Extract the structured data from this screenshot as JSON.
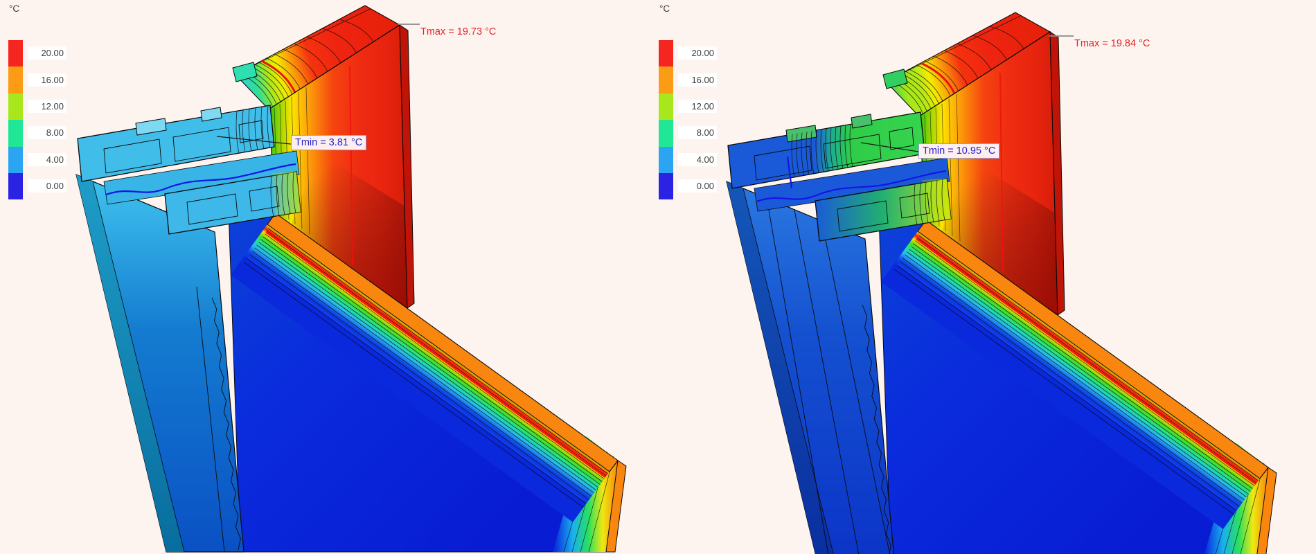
{
  "legend": {
    "unit": "°C",
    "values": [
      "20.00",
      "16.00",
      "12.00",
      "8.00",
      "4.00",
      "0.00"
    ],
    "colors": [
      "#f5261f",
      "#fb9b16",
      "#a8e71b",
      "#20e795",
      "#2ba4f2",
      "#2a23e3"
    ]
  },
  "panels": [
    {
      "name": "left-view",
      "tmax_label": "Tmax = 19.73 °C",
      "tmin_label": "Tmin = 3.81 °C",
      "theme": {
        "frame_cold": "#41bdea",
        "frame_warm": "#41bdea",
        "frame_block": "#7fd9f3",
        "jamb_top": "#3fc2ee",
        "jamb_mid": "#147cd0",
        "jamb_bottom": "#0a50c4",
        "jamb_edge_top": "#1e9cc8",
        "jamb_edge_bottom": "#086d9e",
        "gap": "#38b4e6",
        "band_start": "#38c8e8",
        "band_mid": "#30e090",
        "tip_block": "#2ee0b0"
      }
    },
    {
      "name": "right-view",
      "tmax_label": "Tmax = 19.84 °C",
      "tmin_label": "Tmin = 10.95 °C",
      "theme": {
        "frame_cold": "#1a5ad8",
        "frame_warm": "#2ecc48",
        "frame_block": "#49c06c",
        "jamb_top": "#2a78e0",
        "jamb_mid": "#1450d0",
        "jamb_bottom": "#0c34c8",
        "jamb_edge_top": "#1456b8",
        "jamb_edge_bottom": "#0a2ea0",
        "gap": "#1a5ad8",
        "band_start": "#2ed060",
        "band_mid": "#a8e818",
        "tip_block": "#30d060"
      }
    }
  ],
  "annotations": {
    "tmax_color": "#e62329",
    "tmin_color": "#2323cc",
    "tmin_box_bg": "#fdeff0",
    "tmin_box_border": "#9a9ade",
    "leader_tmax_color": "#8a8a8a",
    "leader_tmin_color": "#1a1a1a"
  },
  "scene_colors": {
    "background": "#fdf4ef",
    "wall_red": "#ee2410",
    "wall_dark_red": "#bf1407",
    "band_orange": "#f8860f",
    "leaf_blue": "#0a28dc",
    "isotherm_blue": "#1414e6",
    "isotherm_red": "#f01212",
    "outline": "#0a0a0a"
  }
}
